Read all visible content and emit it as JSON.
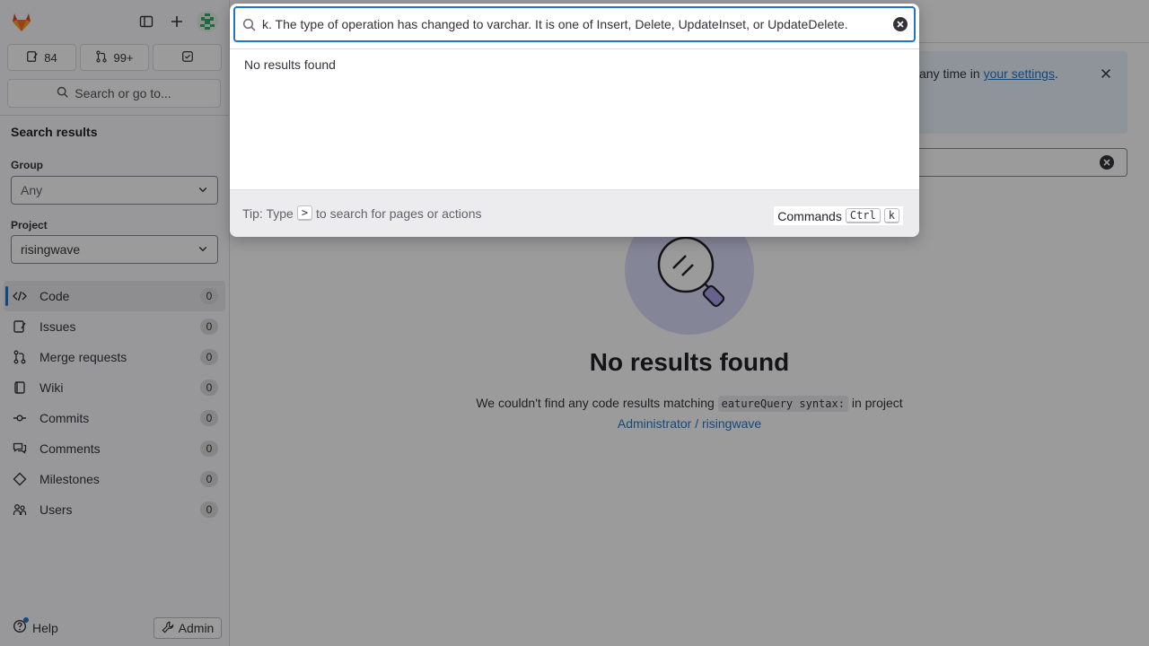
{
  "sidebar": {
    "counts": {
      "issues": "84",
      "merge_requests": "99+"
    },
    "search_label": "Search or go to...",
    "title": "Search results",
    "group": {
      "label": "Group",
      "value": "Any"
    },
    "project": {
      "label": "Project",
      "value": "risingwave"
    },
    "nav": [
      {
        "label": "Code",
        "count": "0",
        "icon": "code-icon"
      },
      {
        "label": "Issues",
        "count": "0",
        "icon": "issues-icon"
      },
      {
        "label": "Merge requests",
        "count": "0",
        "icon": "merge-request-icon"
      },
      {
        "label": "Wiki",
        "count": "0",
        "icon": "book-icon"
      },
      {
        "label": "Commits",
        "count": "0",
        "icon": "commit-icon"
      },
      {
        "label": "Comments",
        "count": "0",
        "icon": "comments-icon"
      },
      {
        "label": "Milestones",
        "count": "0",
        "icon": "milestone-icon"
      },
      {
        "label": "Users",
        "count": "0",
        "icon": "users-icon"
      }
    ],
    "help": "Help",
    "admin": "Admin"
  },
  "main": {
    "alert": {
      "text": "any time in ",
      "link": "your settings",
      "suffix": "."
    },
    "empty": {
      "title": "No results found",
      "desc_prefix": "We couldn't find any code results matching",
      "query": "eatureQuery syntax:",
      "desc_mid": "in project",
      "project_link": "Administrator / risingwave"
    }
  },
  "modal": {
    "input_value": "k. The type of operation has changed to varchar. It is one of Insert, Delete, UpdateInset, or UpdateDelete.",
    "no_results": "No results found",
    "tip_prefix": "Tip: Type",
    "tip_key": ">",
    "tip_suffix": "to search for pages or actions",
    "commands_label": "Commands",
    "commands_key1": "Ctrl",
    "commands_key2": "k"
  },
  "colors": {
    "accent": "#1f75cb",
    "overlay": "rgba(5,5,6,0.4)",
    "illustration_bg": "#dbdbfa"
  }
}
